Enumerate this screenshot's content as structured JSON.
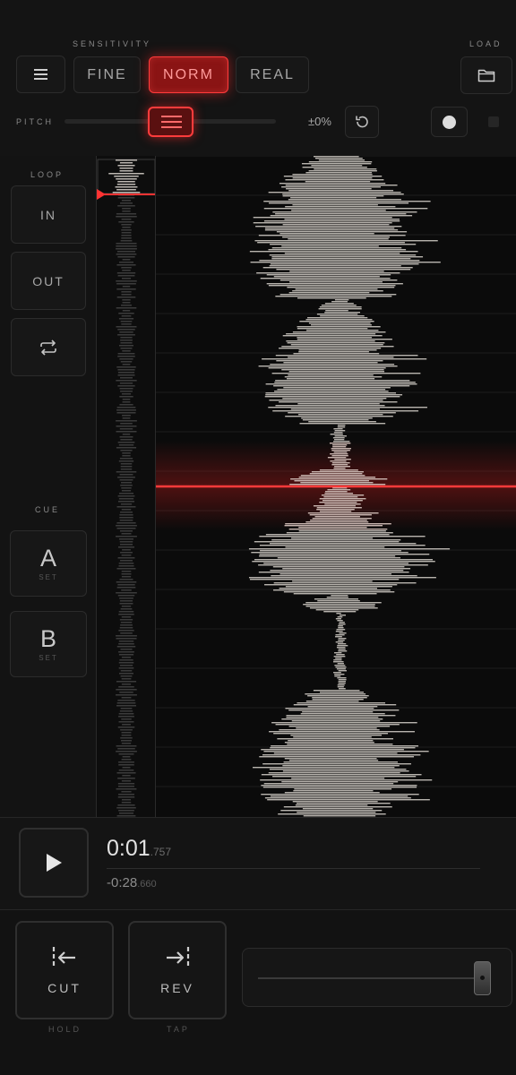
{
  "header": {
    "sensitivity_label": "SENSITIVITY",
    "load_label": "LOAD",
    "modes": [
      "FINE",
      "NORM",
      "REAL"
    ],
    "active_mode": "NORM",
    "pitch_label": "PITCH",
    "pitch_value": "±0%"
  },
  "sidebar": {
    "loop_label": "LOOP",
    "loop_in": "IN",
    "loop_out": "OUT",
    "cue_label": "CUE",
    "cue_a": "A",
    "cue_a_sub": "SET",
    "cue_b": "B",
    "cue_b_sub": "SET"
  },
  "transport": {
    "time_main": "0:01",
    "time_ms": ".757",
    "remaining_main": "-0:28",
    "remaining_ms": ".660"
  },
  "controls": {
    "cut_label": "CUT",
    "cut_sub": "HOLD",
    "rev_label": "REV",
    "rev_sub": "TAP",
    "fader_level": 1.0
  },
  "colors": {
    "accent": "#ff3333",
    "waveform": "#b9b4ae",
    "background": "#141414"
  }
}
